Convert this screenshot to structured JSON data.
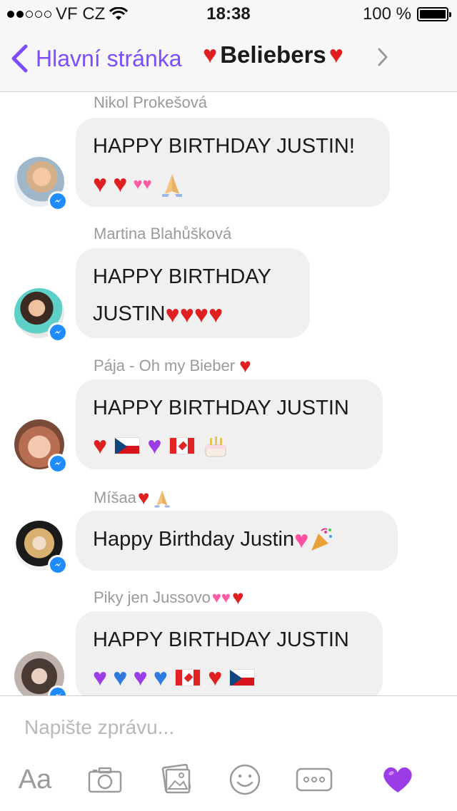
{
  "status_bar": {
    "carrier": "VF CZ",
    "time": "18:38",
    "battery": "100 %"
  },
  "header": {
    "back_label": "Hlavní stránka",
    "title": "Beliebers"
  },
  "messages": [
    {
      "sender": "Nikol Prokešová",
      "line1": "HAPPY BIRTHDAY JUSTIN!"
    },
    {
      "sender": "Martina Blahůšková",
      "line1": "HAPPY BIRTHDAY",
      "line2": "JUSTIN"
    },
    {
      "sender": "Pája - Oh my Bieber",
      "line1": "HAPPY BIRTHDAY JUSTIN"
    },
    {
      "sender": "Míšaa",
      "line1": "Happy Birthday Justin"
    },
    {
      "sender": "Piky jen Jussovo",
      "line1": "HAPPY BIRTHDAY JUSTIN"
    }
  ],
  "composer": {
    "placeholder": "Napište zprávu...",
    "aa_label": "Aa"
  },
  "colors": {
    "accent": "#7b4dff",
    "bubble": "#f0f0f0",
    "messenger_badge": "#1e8bff"
  }
}
